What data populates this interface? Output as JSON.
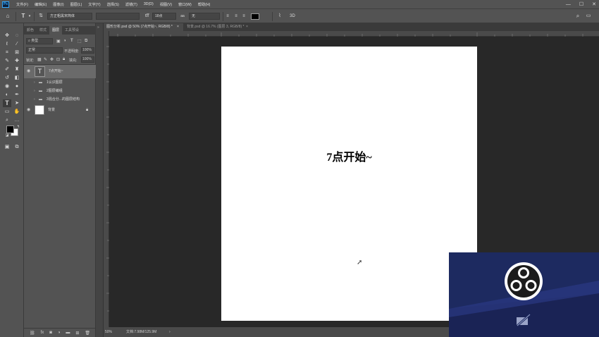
{
  "app": {
    "logo_text": "Ps"
  },
  "menu": [
    "文件(F)",
    "编辑(E)",
    "图像(I)",
    "图层(L)",
    "文字(Y)",
    "选择(S)",
    "滤镜(T)",
    "3D(D)",
    "视图(V)",
    "窗口(W)",
    "帮助(H)"
  ],
  "options": {
    "font_family": "方正粗黑宋简体",
    "font_size": "18点",
    "anti_alias": "无",
    "color": "#000000"
  },
  "panels": {
    "tabs": [
      "颜色",
      "样式",
      "图层",
      "工具预设"
    ],
    "active_tab": "图层",
    "filter_label": "类型",
    "blend_mode": "正常",
    "opacity_label": "不透明度:",
    "opacity_value": "100%",
    "lock_label": "锁定:",
    "fill_label": "填充:",
    "fill_value": "100%",
    "layers": [
      {
        "name": "7点开始~",
        "type": "text",
        "visible": true,
        "selected": true
      },
      {
        "name": "1认识图层",
        "type": "folder",
        "visible": false
      },
      {
        "name": "2图层编组",
        "type": "folder",
        "visible": false
      },
      {
        "name": "3混合分...的图层结构",
        "type": "folder",
        "visible": false
      },
      {
        "name": "背景",
        "type": "background",
        "visible": true
      }
    ]
  },
  "doc_tabs": [
    {
      "label": "图形分析.psd @ 50% (7点开始~, RGB/8) *",
      "active": true
    },
    {
      "label": "背景.psd @ 16.7% (图层 3, RGB/8) *",
      "active": false
    }
  ],
  "document": {
    "text": "7点开始~",
    "background_color": "#ffffff"
  },
  "status": {
    "zoom": "50%",
    "doc_size": "文档:7.98M/125.9M"
  },
  "colors": {
    "accent": "#31a8ff",
    "panel_bg": "#535353",
    "canvas_bg": "#282828",
    "foreground": "#000000",
    "background": "#ffffff"
  }
}
